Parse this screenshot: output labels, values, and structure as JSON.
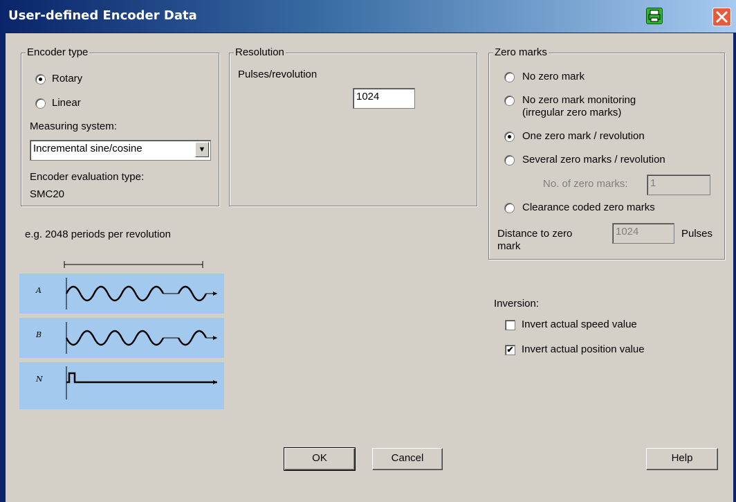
{
  "window": {
    "title": "User-defined Encoder Data"
  },
  "encoder_type": {
    "title": "Encoder type",
    "options": [
      {
        "label": "Rotary",
        "selected": true
      },
      {
        "label": "Linear",
        "selected": false
      }
    ],
    "measuring_system_label": "Measuring system:",
    "measuring_system_value": "Incremental sine/cosine",
    "evaluation_label": "Encoder evaluation type:",
    "evaluation_value": "SMC20"
  },
  "resolution": {
    "title": "Resolution",
    "pulses_label": "Pulses/revolution",
    "pulses_value": "1024"
  },
  "zero_marks": {
    "title": "Zero marks",
    "options": [
      {
        "label": "No zero mark",
        "selected": false
      },
      {
        "label": "No zero mark monitoring",
        "label2": "(irregular zero marks)",
        "selected": false
      },
      {
        "label": "One zero mark / revolution",
        "selected": true
      },
      {
        "label": "Several zero marks / revolution",
        "selected": false
      },
      {
        "label": "Clearance coded zero marks",
        "selected": false
      }
    ],
    "count_label": "No. of zero marks:",
    "count_value": "1",
    "distance_label": "Distance to zero",
    "distance_label2": "mark",
    "distance_value": "1024",
    "distance_unit": "Pulses"
  },
  "diagram": {
    "caption": "e.g. 2048 periods per revolution",
    "signals": [
      "A",
      "B",
      "N"
    ]
  },
  "inversion": {
    "title": "Inversion:",
    "options": [
      {
        "label": "Invert actual speed value",
        "checked": false
      },
      {
        "label": "Invert actual position value",
        "checked": true
      }
    ]
  },
  "buttons": {
    "ok": "OK",
    "cancel": "Cancel",
    "help": "Help"
  },
  "colors": {
    "title_start": "#0a246a",
    "title_end": "#a6caf0",
    "face": "#d4d0c8",
    "diagram_bg": "#a4c9ee"
  },
  "icons": {
    "print": "printer-icon",
    "close": "close-icon"
  }
}
